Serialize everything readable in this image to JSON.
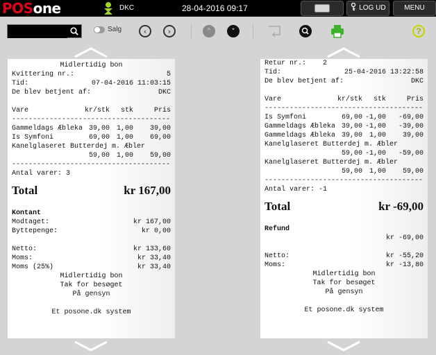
{
  "topbar": {
    "logo_pos": "POS",
    "logo_one": "one",
    "user": "DKC",
    "datetime": "28-04-2016 09:17",
    "keyboard_icon": "keyboard-icon",
    "logout_label": "LOG UD",
    "menu_label": "MENU"
  },
  "toolbar": {
    "search_value": "",
    "search_placeholder": "",
    "toggle_label": "Salg",
    "icons": [
      "search-icon",
      "toggle-switch",
      "chevron-left-icon",
      "chevron-right-icon",
      "arrow-up-icon",
      "arrow-down-icon",
      "return-icon",
      "zoom-icon",
      "print-icon",
      "help-icon"
    ],
    "help_label": "?"
  },
  "colors": {
    "brand_red": "#e3001b",
    "user_green": "#9fd12a",
    "print_green": "#3cb32a",
    "help_yellow": "#c8d400"
  },
  "receipt1": {
    "title": "Midlertidig bon",
    "kvittering_label": "Kvittering nr.:",
    "kvittering_value": "5",
    "tid_label": "Tid:",
    "tid_value": "07-04-2016 11:03:15",
    "betjent_label": "De blev betjent af:",
    "betjent_value": "DKC",
    "headers": {
      "vare": "Vare",
      "krstk": "kr/stk",
      "stk": "stk",
      "pris": "Pris"
    },
    "dashes": "--------------------------------------------",
    "items": [
      {
        "name": "Gammeldags Æblekage",
        "krstk": "39,00",
        "stk": "1,00",
        "pris": "39,00"
      },
      {
        "name": "Is Symfoni",
        "krstk": "69,00",
        "stk": "1,00",
        "pris": "69,00"
      }
    ],
    "item3_name": "Kanelglaseret Butterdej m. Æbler",
    "item3_krstk": "59,00",
    "item3_stk": "1,00",
    "item3_pris": "59,00",
    "antal": "Antal varer: 3",
    "total_label": "Total",
    "total_value": "kr 167,00",
    "payment_type": "Kontant",
    "modtaget_label": "Modtaget:",
    "modtaget_value": "kr 167,00",
    "bytte_label": "Byttepenge:",
    "bytte_value": "kr 0,00",
    "netto_label": "Netto:",
    "netto_value": "kr 133,60",
    "moms_label": "Moms:",
    "moms_value": "kr 33,40",
    "moms25_label": "Moms (25%)",
    "moms25_value": "kr 33,40",
    "footer_title": "Midlertidig bon",
    "thanks": "Tak for besøget",
    "bye": "På gensyn",
    "system": "Et posone.dk system"
  },
  "receipt2": {
    "retur_label": "Retur nr.:",
    "retur_value": "2",
    "tid_label": "Tid:",
    "tid_value": "25-04-2016 13:22:58",
    "betjent_label": "De blev betjent af:",
    "betjent_value": "DKC",
    "headers": {
      "vare": "Vare",
      "krstk": "kr/stk",
      "stk": "stk",
      "pris": "Pris"
    },
    "dashes": "--------------------------------------------",
    "items": [
      {
        "name": "Is Symfoni",
        "krstk": "69,00",
        "stk": "-1,00",
        "pris": "-69,00"
      },
      {
        "name": "Gammeldags Æblekage",
        "krstk": "39,00",
        "stk": "-1,00",
        "pris": "-39,00"
      },
      {
        "name": "Gammeldags Æblekage",
        "krstk": "39,00",
        "stk": "1,00",
        "pris": "39,00"
      }
    ],
    "kanel1_name": "Kanelglaseret Butterdej m. Æbler",
    "kanel1_krstk": "59,00",
    "kanel1_stk": "-1,00",
    "kanel1_pris": "-59,00",
    "kanel2_name": "Kanelglaseret Butterdej m. Æbler",
    "kanel2_krstk": "59,00",
    "kanel2_stk": "1,00",
    "kanel2_pris": "59,00",
    "antal": "Antal varer: -1",
    "total_label": "Total",
    "total_value": "kr -69,00",
    "payment_type": "Refund",
    "refund_value": "kr -69,00",
    "netto_label": "Netto:",
    "netto_value": "kr -55,20",
    "moms_label": "Moms:",
    "moms_value": "kr -13,80",
    "footer_title": "Midlertidig bon",
    "thanks": "Tak for besøget",
    "bye": "På gensyn",
    "system": "Et posone.dk system"
  }
}
